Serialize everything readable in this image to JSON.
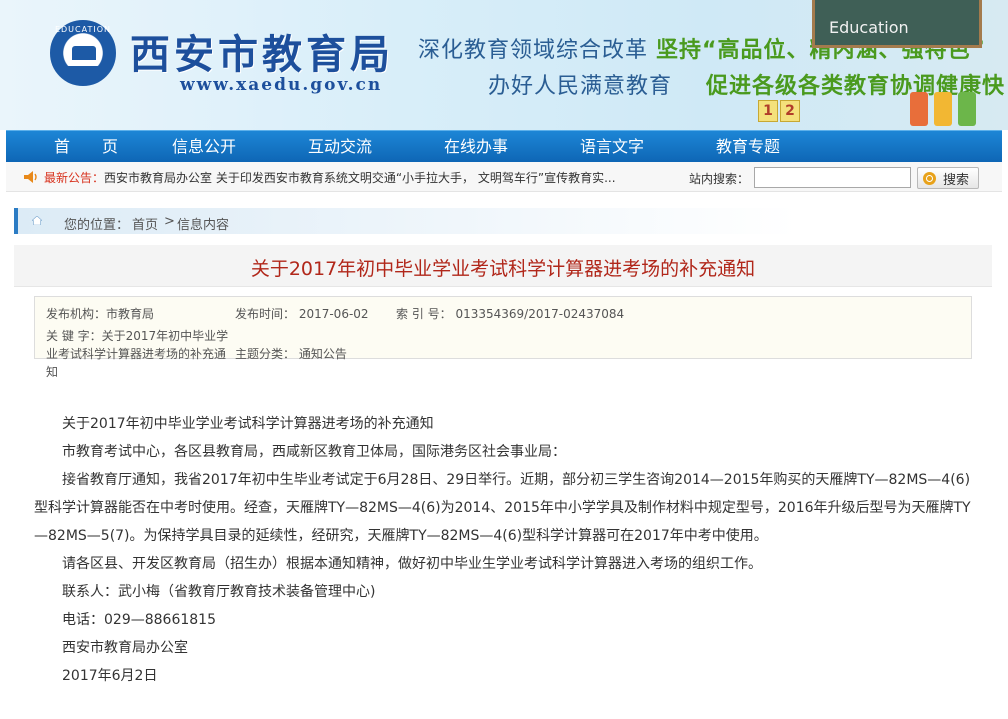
{
  "header": {
    "seal_text": "EDUCATION",
    "site_name": "西安市教育局",
    "site_url": "www.xaedu.gov.cn",
    "slogan_line1_part1": "深化教育领域综合改革",
    "slogan_line1_part2": "坚持“高品位、精内涵、强特色”",
    "slogan_line2_part1": "办好人民满意教育",
    "slogan_line2_part2": "促进各级各类教育协调健康快",
    "chalkboard_text": "Education",
    "deco_numbers": [
      "1",
      "2"
    ]
  },
  "nav": {
    "items": [
      {
        "label": "首　　页"
      },
      {
        "label": "信息公开"
      },
      {
        "label": "互动交流"
      },
      {
        "label": "在线办事"
      },
      {
        "label": "语言文字"
      },
      {
        "label": "教育专题"
      }
    ]
  },
  "notice": {
    "label": "最新公告：",
    "text": "西安市教育局办公室 关于印发西安市教育系统文明交通“小手拉大手， 文明驾车行”宣传教育实...",
    "search_label": "站内搜索：",
    "search_value": "",
    "search_button": "搜索"
  },
  "breadcrumb": {
    "label": "您的位置：",
    "home": "首页",
    "separator": ">",
    "current": "信息内容"
  },
  "article": {
    "title": "关于2017年初中毕业学业考试科学计算器进考场的补充通知",
    "meta": {
      "publisher": "发布机构：市教育局",
      "date": "发布时间： 2017-06-02",
      "index": "索 引 号： 013354369/2017-02437084",
      "keywords": "关 键 字：关于2017年初中毕业学业考试科学计算器进考场的补充通知",
      "category": "主题分类： 通知公告"
    },
    "paragraphs": [
      "关于2017年初中毕业学业考试科学计算器进考场的补充通知",
      "市教育考试中心，各区县教育局，西咸新区教育卫体局，国际港务区社会事业局：",
      "接省教育厅通知，我省2017年初中生毕业考试定于6月28日、29日举行。近期，部分初三学生咨询2014—2015年购买的天雁牌TY—82MS—4(6)型科学计算器能否在中考时使用。经查，天雁牌TY—82MS—4(6)为2014、2015年中小学学具及制作材料中规定型号，2016年升级后型号为天雁牌TY—82MS—5(7)。为保持学具目录的延续性，经研究，天雁牌TY—82MS—4(6)型科学计算器可在2017年中考中使用。",
      "请各区县、开发区教育局（招生办）根据本通知精神，做好初中毕业生学业考试科学计算器进入考场的组织工作。",
      "联系人：武小梅（省教育厅教育技术装备管理中心)",
      "电话：029—88661815",
      "西安市教育局办公室",
      "2017年6月2日"
    ]
  },
  "colors": {
    "nav_bg": "#0e66b5",
    "title_red": "#b1271a",
    "notice_red": "#d8331f",
    "brand_blue": "#1d4f9c",
    "slogan_green": "#4a9a1e"
  }
}
